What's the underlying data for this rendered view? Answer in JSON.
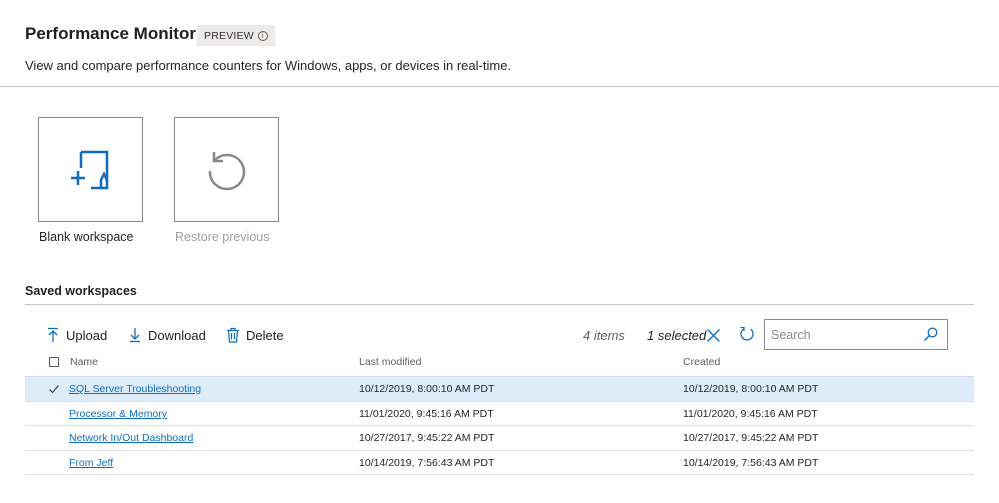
{
  "header": {
    "title": "Performance Monitor",
    "badge": "PREVIEW",
    "badge_icon": "info-icon",
    "subtitle": "View and compare performance counters for Windows, apps, or devices in real-time."
  },
  "tiles": [
    {
      "label": "Blank workspace",
      "icon": "new-workspace-icon",
      "enabled": true
    },
    {
      "label": "Restore previous",
      "icon": "restore-icon",
      "enabled": false
    }
  ],
  "saved": {
    "title": "Saved workspaces",
    "commands": {
      "upload": "Upload",
      "download": "Download",
      "delete": "Delete"
    },
    "items_count": "4 items",
    "selected_count": "1 selected",
    "search": {
      "placeholder": "Search",
      "value": ""
    },
    "columns": {
      "name": "Name",
      "modified": "Last modified",
      "created": "Created"
    },
    "rows": [
      {
        "name": "SQL Server Troubleshooting",
        "modified": "10/12/2019, 8:00:10 AM PDT",
        "created": "10/12/2019, 8:00:10 AM PDT",
        "selected": true
      },
      {
        "name": "Processor & Memory",
        "modified": "11/01/2020, 9:45:16 AM PDT",
        "created": "11/01/2020, 9:45:16 AM PDT",
        "selected": false
      },
      {
        "name": "Network In/Out Dashboard",
        "modified": "10/27/2017, 9:45:22 AM PDT",
        "created": "10/27/2017, 9:45:22 AM PDT",
        "selected": false
      },
      {
        "name": "From Jeff",
        "modified": "10/14/2019, 7:56:43 AM PDT",
        "created": "10/14/2019, 7:56:43 AM PDT",
        "selected": false
      }
    ]
  },
  "colors": {
    "accent": "#0f6cbd",
    "link": "#106ebe",
    "selected_row": "#deecf9",
    "disabled_text": "#a19f9d"
  }
}
